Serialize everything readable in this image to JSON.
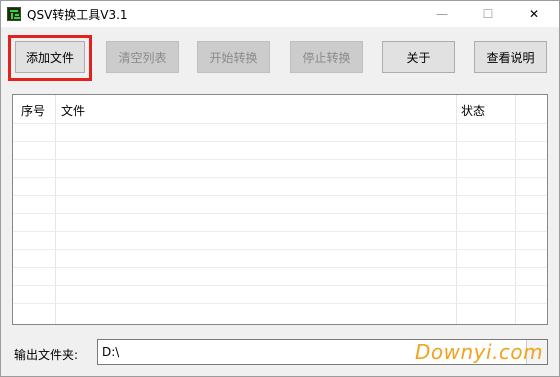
{
  "window": {
    "title": "QSV转换工具V3.1",
    "minimize_glyph": "—",
    "maximize_glyph": "☐",
    "close_glyph": "✕"
  },
  "toolbar": {
    "add_file": "添加文件",
    "clear_list": "清空列表",
    "start_convert": "开始转换",
    "stop_convert": "停止转换",
    "about": "关于",
    "help": "查看说明"
  },
  "list": {
    "columns": [
      "序号",
      "文件",
      "状态"
    ]
  },
  "output": {
    "label": "输出文件夹:",
    "value": "D:\\"
  },
  "watermark": "Downyi.com",
  "colors": {
    "highlight": "#e2221f",
    "watermark": "#f2a21b"
  },
  "icons": {
    "app": "app-icon"
  }
}
